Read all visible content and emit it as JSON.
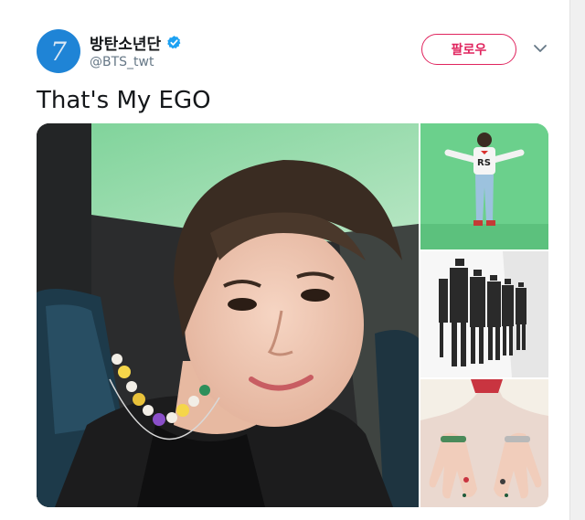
{
  "header": {
    "avatar_glyph": "7",
    "display_name": "방탄소년단",
    "handle": "@BTS_twt",
    "follow_label": "팔로우"
  },
  "tweet": {
    "text": "That's My EGO"
  },
  "colors": {
    "accent": "#e0245e",
    "verified": "#1da1f2",
    "avatar_bg": "#1f84d6",
    "green_screen": "#6bd08c"
  },
  "icons": {
    "verified": "verified-badge-icon",
    "more": "chevron-down-icon"
  }
}
